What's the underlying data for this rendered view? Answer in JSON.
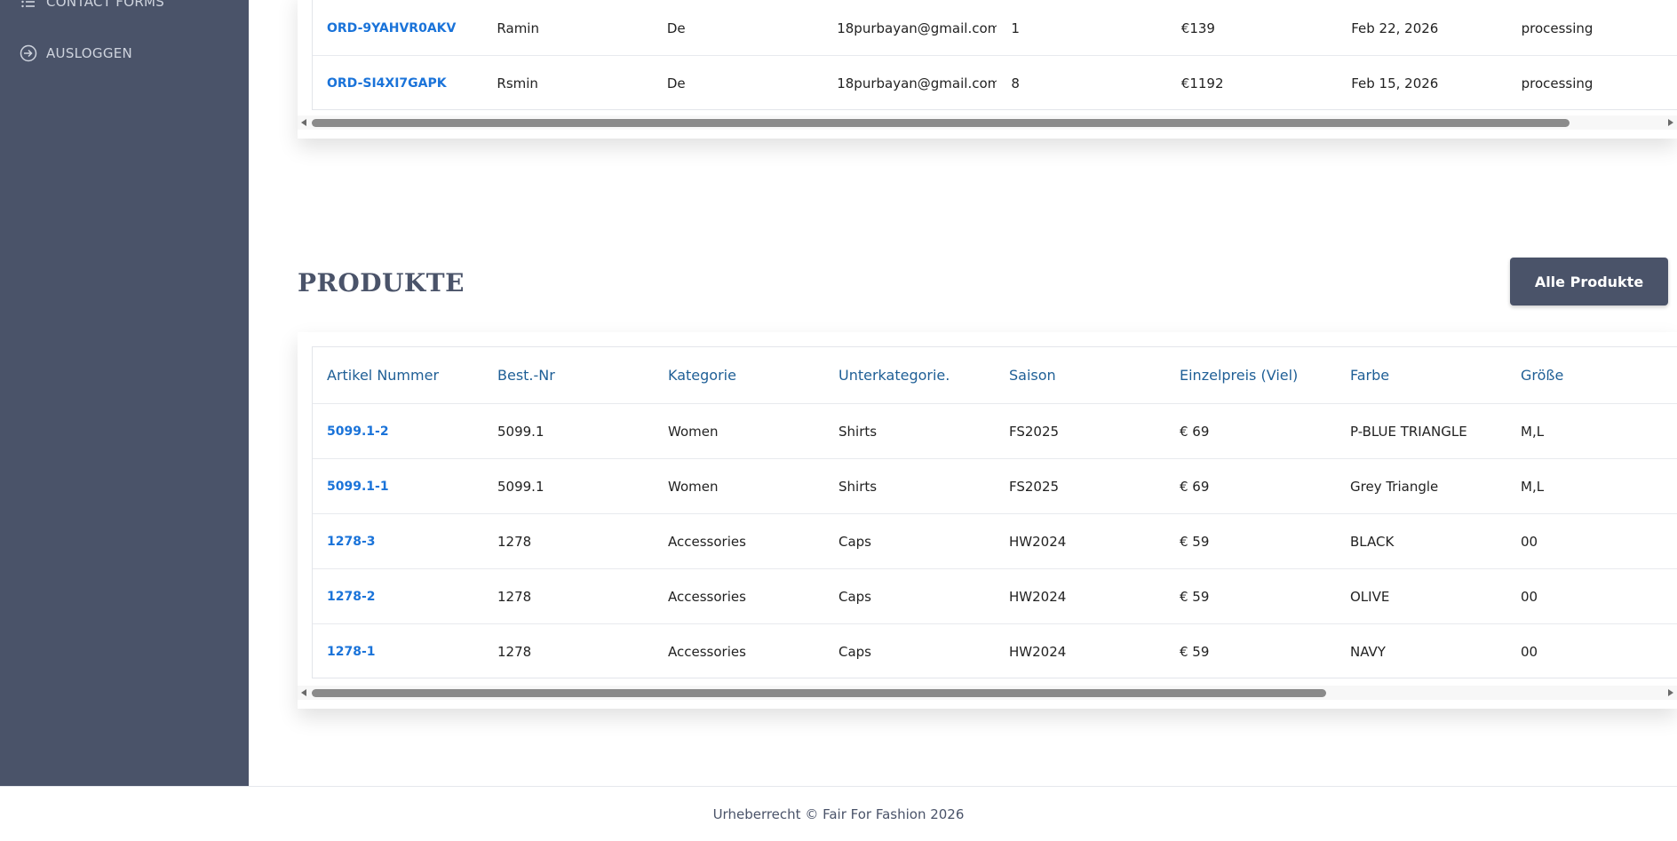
{
  "sidebar": {
    "items": [
      {
        "label": "CONTACT FORMS",
        "icon": "list-icon"
      },
      {
        "label": "AUSLOGGEN",
        "icon": "logout-icon"
      }
    ]
  },
  "orders": {
    "rows": [
      [
        "ORD-9YAHVR0AKV",
        "Ramin",
        "De",
        "18purbayan@gmail.com",
        "1",
        "€139",
        "Feb 22, 2026",
        "processing"
      ],
      [
        "ORD-SI4XI7GAPK",
        "Rsmin",
        "De",
        "18purbayan@gmail.com",
        "8",
        "€1192",
        "Feb 15, 2026",
        "processing"
      ]
    ]
  },
  "products": {
    "title": "PRODUKTE",
    "all_button": "Alle Produkte",
    "headers": [
      "Artikel Nummer",
      "Best.-Nr",
      "Kategorie",
      "Unterkategorie.",
      "Saison",
      "Einzelpreis (Viel)",
      "Farbe",
      "Größe"
    ],
    "rows": [
      [
        "5099.1-2",
        "5099.1",
        "Women",
        "Shirts",
        "FS2025",
        "€ 69",
        "P-BLUE TRIANGLE",
        "M,L"
      ],
      [
        "5099.1-1",
        "5099.1",
        "Women",
        "Shirts",
        "FS2025",
        "€ 69",
        "Grey Triangle",
        "M,L"
      ],
      [
        "1278-3",
        "1278",
        "Accessories",
        "Caps",
        "HW2024",
        "€ 59",
        "BLACK",
        "00"
      ],
      [
        "1278-2",
        "1278",
        "Accessories",
        "Caps",
        "HW2024",
        "€ 59",
        "OLIVE",
        "00"
      ],
      [
        "1278-1",
        "1278",
        "Accessories",
        "Caps",
        "HW2024",
        "€ 59",
        "NAVY",
        "00"
      ]
    ]
  },
  "footer": {
    "text": "Urheberrecht © Fair For Fashion 2026"
  },
  "colors": {
    "sidebar": "#4a5369",
    "link": "#1a73d9",
    "header_text": "#1f5f96"
  }
}
